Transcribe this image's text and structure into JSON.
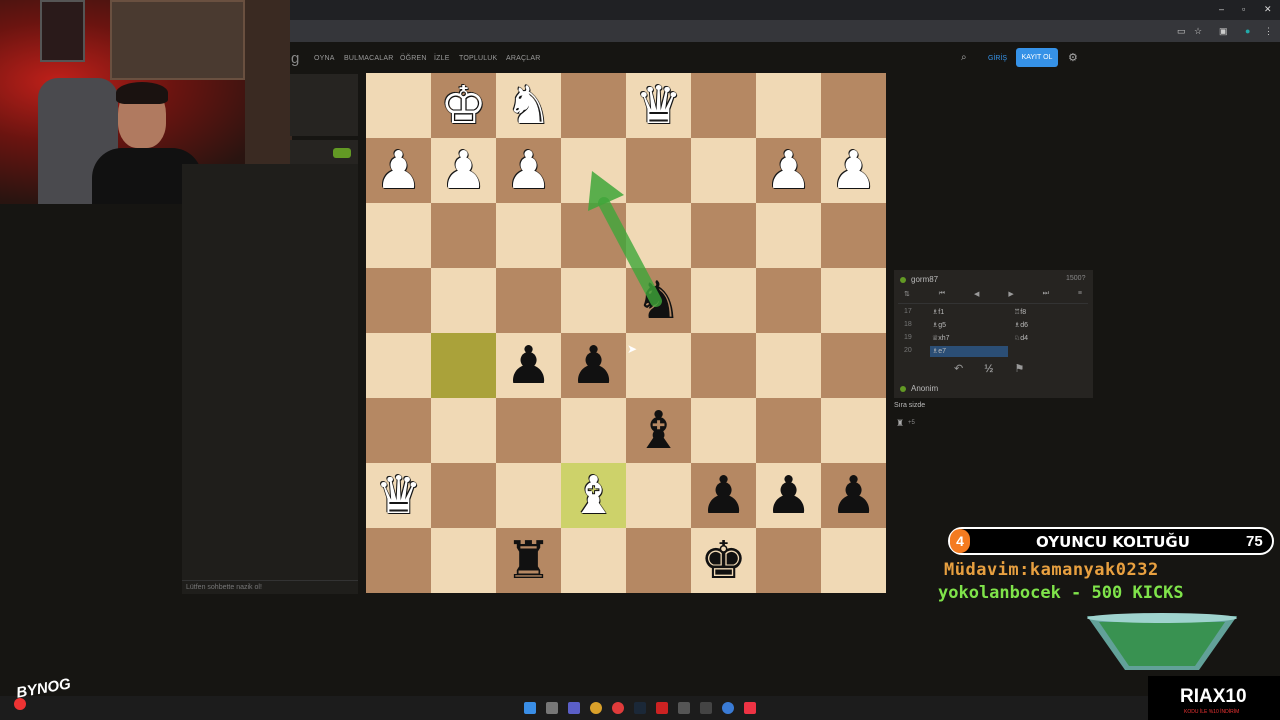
{
  "nav": {
    "logo_fragment": "g",
    "items": [
      "OYNA",
      "BULMACALAR",
      "ÖĞREN",
      "İZLE",
      "TOPLULUK",
      "ARAÇLAR"
    ],
    "login": "GİRİŞ",
    "signup": "KAYIT OL"
  },
  "chat": {
    "placeholder": "Lütfen sohbette nazik ol!"
  },
  "board": {
    "rows": [
      [
        "",
        "wK",
        "wN",
        "",
        "wQ",
        "",
        "",
        ""
      ],
      [
        "wP",
        "wP",
        "wP",
        "",
        "",
        "",
        "wP",
        "wP"
      ],
      [
        "",
        "",
        "",
        "",
        "",
        "",
        "",
        ""
      ],
      [
        "",
        "",
        "",
        "",
        "bN",
        "",
        "",
        ""
      ],
      [
        "",
        "",
        "bP",
        "bP",
        "",
        "",
        "",
        ""
      ],
      [
        "",
        "",
        "",
        "",
        "bB",
        "",
        "",
        ""
      ],
      [
        "wQ",
        "",
        "",
        "wB",
        "",
        "bP",
        "bP",
        "bP"
      ],
      [
        "",
        "",
        "bR",
        "",
        "",
        "bK",
        "",
        ""
      ]
    ],
    "highlighted": [
      "4-1",
      "6-3"
    ],
    "arrow_color": "#3fa63a"
  },
  "game": {
    "top_player": "gorm87",
    "top_rating": "1500?",
    "bottom_player": "Anonim",
    "moves": [
      {
        "no": "17",
        "white": "♗f1",
        "black": "♖f8"
      },
      {
        "no": "18",
        "white": "♗g5",
        "black": "♗d6"
      },
      {
        "no": "19",
        "white": "♕xh7",
        "black": "♘d4"
      },
      {
        "no": "20",
        "white": "♗e7",
        "black": ""
      }
    ],
    "draw_label": "½",
    "turn_note": "Sıra sizde",
    "material": "+5"
  },
  "overlay": {
    "badge": "4",
    "title": "OYUNCU KOLTUĞU",
    "count": "75",
    "line1": "Müdavim:kamanyak0232",
    "line2": "yokolanbocek - 500 KICKS",
    "brand": "RIAX10",
    "brand_sub": "KODU İLE %10 İNDİRİM",
    "logo": "BYNOG"
  },
  "colors": {
    "accent": "#3692e7",
    "online": "#629924",
    "light_sq": "#f0d9b5",
    "dark_sq": "#b58863"
  }
}
